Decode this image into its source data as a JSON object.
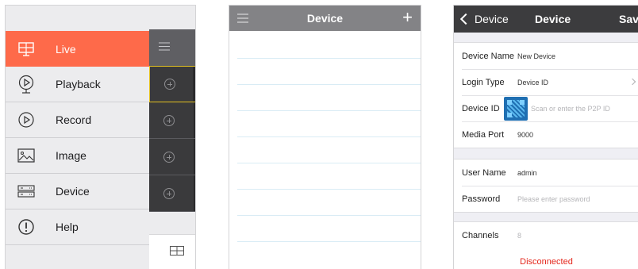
{
  "panel1": {
    "menu": [
      {
        "label": "Live",
        "icon": "monitor-icon",
        "active": true
      },
      {
        "label": "Playback",
        "icon": "playback-icon",
        "active": false
      },
      {
        "label": "Record",
        "icon": "record-icon",
        "active": false
      },
      {
        "label": "Image",
        "icon": "image-icon",
        "active": false
      },
      {
        "label": "Device",
        "icon": "device-icon",
        "active": false
      },
      {
        "label": "Help",
        "icon": "help-icon",
        "active": false
      }
    ],
    "strip_icons": [
      "menu-icon",
      "add-channel-icon",
      "split-screen-icon"
    ]
  },
  "panel2": {
    "title": "Device",
    "add_symbol": "+"
  },
  "panel3": {
    "back_label": "Device",
    "title": "Device",
    "save_label": "Save",
    "fields": {
      "device_name": {
        "label": "Device Name",
        "value": "New Device"
      },
      "login_type": {
        "label": "Login Type",
        "value": "Device ID"
      },
      "device_id": {
        "label": "Device ID",
        "placeholder": "Scan or enter the P2P ID"
      },
      "media_port": {
        "label": "Media Port",
        "value": "9000"
      },
      "user_name": {
        "label": "User Name",
        "value": "admin"
      },
      "password": {
        "label": "Password",
        "placeholder": "Please enter password"
      },
      "channels": {
        "label": "Channels",
        "value": "8"
      }
    },
    "status": "Disconnected"
  },
  "colors": {
    "accent": "#fe6a4a",
    "nav_gray": "#838386",
    "nav_dark": "#3c3c3e",
    "status_red": "#e4261b",
    "selected_border": "#e2c021"
  }
}
